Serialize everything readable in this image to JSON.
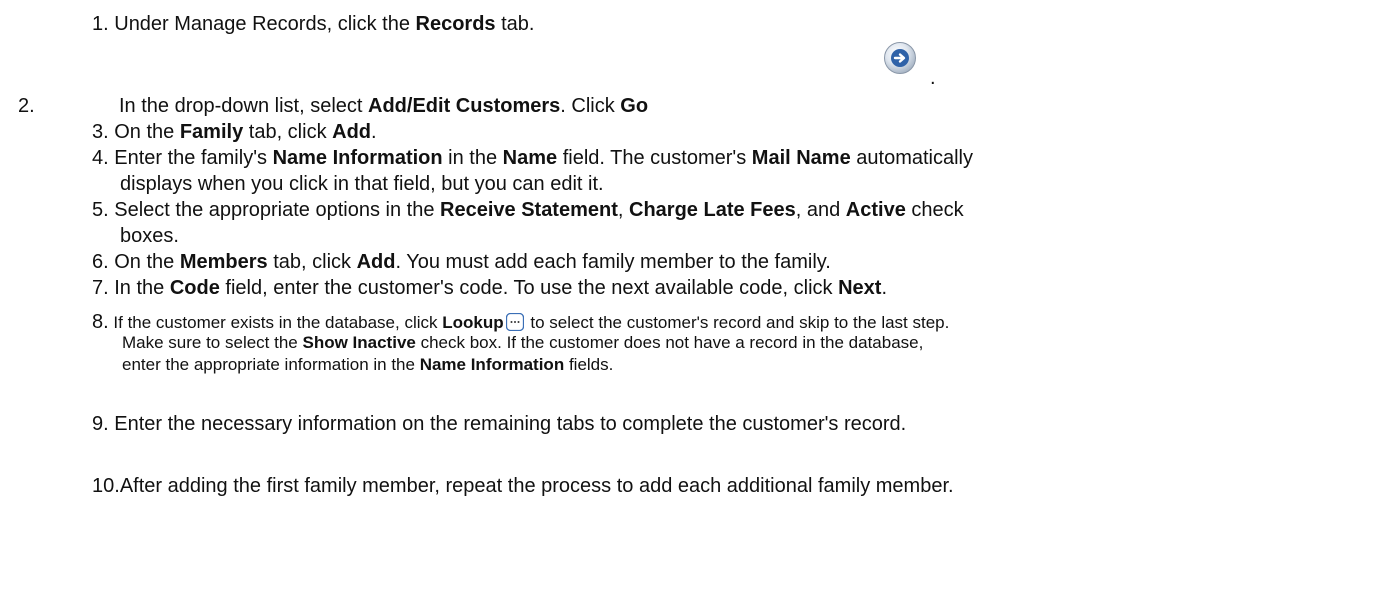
{
  "steps": {
    "s1": {
      "num": "1.",
      "pre": " Under Manage Records, click the ",
      "b1": "Records",
      "post": " tab."
    },
    "s2": {
      "num": "2.",
      "pre": "In the drop-down list, select ",
      "b1": "Add/Edit Customers",
      "mid": ". Click ",
      "b2": "Go",
      "dot": "."
    },
    "s3": {
      "num": "3.",
      "pre": " On the ",
      "b1": "Family",
      "mid": " tab, click ",
      "b2": "Add",
      "post": "."
    },
    "s4": {
      "num": "4.",
      "pre": " Enter the family's ",
      "b1": "Name Information",
      "mid1": " in the ",
      "b2": "Name",
      "mid2": " field. The customer's ",
      "b3": "Mail Name",
      "post": " automatically",
      "line2": "displays when you click in that field, but you can edit it."
    },
    "s5": {
      "num": "5.",
      "pre": " Select the appropriate options in the ",
      "b1": "Receive Statement",
      "mid1": ", ",
      "b2": "Charge Late Fees",
      "mid2": ", and ",
      "b3": "Active",
      "post": " check",
      "line2": "boxes."
    },
    "s6": {
      "num": "6.",
      "pre": " On the ",
      "b1": "Members",
      "mid": " tab, click ",
      "b2": "Add",
      "post": ". You must add each family member to the family."
    },
    "s7": {
      "num": "7.",
      "pre": " In the ",
      "b1": "Code",
      "mid": " field, enter the customer's code. To use the next available code, click ",
      "b2": "Next",
      "post": "."
    },
    "s8": {
      "num": "8.",
      "pre": " If the customer exists in the database, click ",
      "b1": "Lookup",
      "post1": " to select the customer's record and skip to the last step.",
      "l2pre": "Make sure to select the ",
      "l2b": "Show Inactive",
      "l2post": " check box. If the customer does not have a record in the database,",
      "l3pre": "enter the appropriate information in the ",
      "l3b": "Name Information",
      "l3post": " fields."
    },
    "s9": {
      "num": "9.",
      "text": " Enter the necessary information on the remaining tabs to complete the customer's record."
    },
    "s10": {
      "num": "10.",
      "text": "After adding the first family member, repeat the process to add each additional family member."
    }
  },
  "icons": {
    "go": "go-arrow-icon",
    "lookup": "lookup-ellipsis-icon",
    "accent": "#3b6fb6"
  }
}
